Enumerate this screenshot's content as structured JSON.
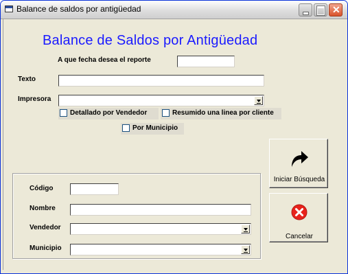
{
  "window": {
    "title": "Balance de saldos por antigüedad",
    "close_symbol": "✕",
    "icons": {
      "app": "app-window-icon",
      "minimize": "minimize-icon",
      "maximize": "maximize-icon",
      "close": "close-icon"
    }
  },
  "form": {
    "heading": "Balance de Saldos por Antigüedad",
    "date_prompt": "A que fecha desea el reporte",
    "date_value": "",
    "texto_label": "Texto",
    "texto_value": "",
    "impresora_label": "Impresora",
    "impresora_value": "",
    "options": {
      "detallado": "Detallado por Vendedor",
      "resumido": "Resumido una linea por cliente",
      "municipio": "Por Municipio"
    }
  },
  "filters": {
    "codigo_label": "Código",
    "codigo_value": "",
    "nombre_label": "Nombre",
    "nombre_value": "",
    "vendedor_label": "Vendedor",
    "vendedor_value": "",
    "municipio_label": "Municipio",
    "municipio_value": ""
  },
  "buttons": {
    "search_label": "Iniciar Búsqueda",
    "search_icon": "forward-arrow-icon",
    "cancel_label": "Cancelar",
    "cancel_icon": "cancel-x-icon"
  },
  "colors": {
    "heading": "#1a1aff",
    "cancel_icon": "#e8231c",
    "window_bg": "#ece9d8"
  }
}
